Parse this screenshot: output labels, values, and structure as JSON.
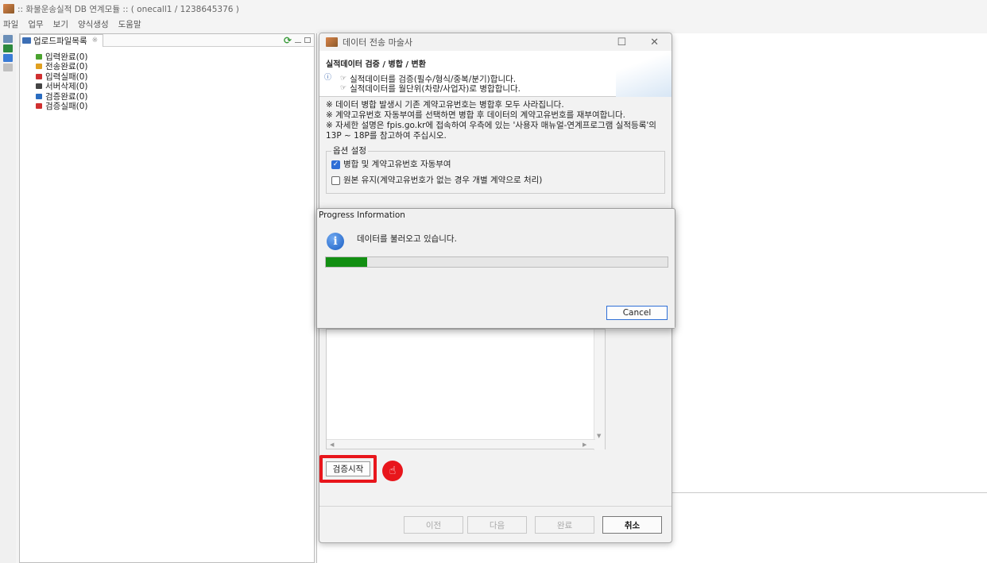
{
  "window": {
    "title": ":: 화물운송실적 DB 연계모듈 :: ( onecall1 / 1238645376 )"
  },
  "menu": {
    "items": [
      "파일",
      "업무",
      "보기",
      "양식생성",
      "도움말"
    ]
  },
  "upload_panel": {
    "tab_label": "업로드파일목록",
    "tab_close": "※",
    "items": [
      {
        "label": "입력완료(0)",
        "color": "#4aa32f"
      },
      {
        "label": "전송완료(0)",
        "color": "#e0a020"
      },
      {
        "label": "입력실패(0)",
        "color": "#d03030"
      },
      {
        "label": "서버삭제(0)",
        "color": "#444444"
      },
      {
        "label": "검증완료(0)",
        "color": "#2a6cc0"
      },
      {
        "label": "검증실패(0)",
        "color": "#d03030"
      }
    ]
  },
  "wizard": {
    "title": "데이터 전송 마술사",
    "banner_title": "실적데이터 검증 / 병합 / 변환",
    "banner_lines": [
      "실적데이터를 검증(필수/형식/중복/분기)합니다.",
      "실적데이터를 월단위(차량/사업자)로 병합합니다."
    ],
    "notes": [
      "※ 데이터 병합 발생시 기존 계약고유번호는 병합후 모두 사라집니다.",
      "※ 계약고유번호 자동부여를 선택하면 병합 후 데이터의 계약고유번호를 재부여합니다.",
      "※ 자세한 설명은 fpis.go.kr에 접속하여 우측에 있는 '사용자 매뉴얼-연계프로그램 실적등록'의",
      "13P ~ 18P를 참고하여 주십시오."
    ],
    "options_title": "옵션 설정",
    "options": [
      {
        "label": "병합 및 계약고유번호 자동부여",
        "checked": true
      },
      {
        "label": "원본 유지(계약고유번호가 없는 경우 개별 계약으로 처리)",
        "checked": false
      }
    ],
    "start_button": "검증시작",
    "footer_buttons": {
      "prev": "이전",
      "next": "다음",
      "finish": "완료",
      "cancel": "취소"
    }
  },
  "progress_dialog": {
    "title": "Progress Information",
    "message": "데이터를 불러오고 있습니다.",
    "progress_fraction": 0.12,
    "cancel": "Cancel"
  },
  "colors": {
    "accent": "#2f6fd6",
    "progress": "#128f12",
    "highlight": "#e8161c"
  }
}
